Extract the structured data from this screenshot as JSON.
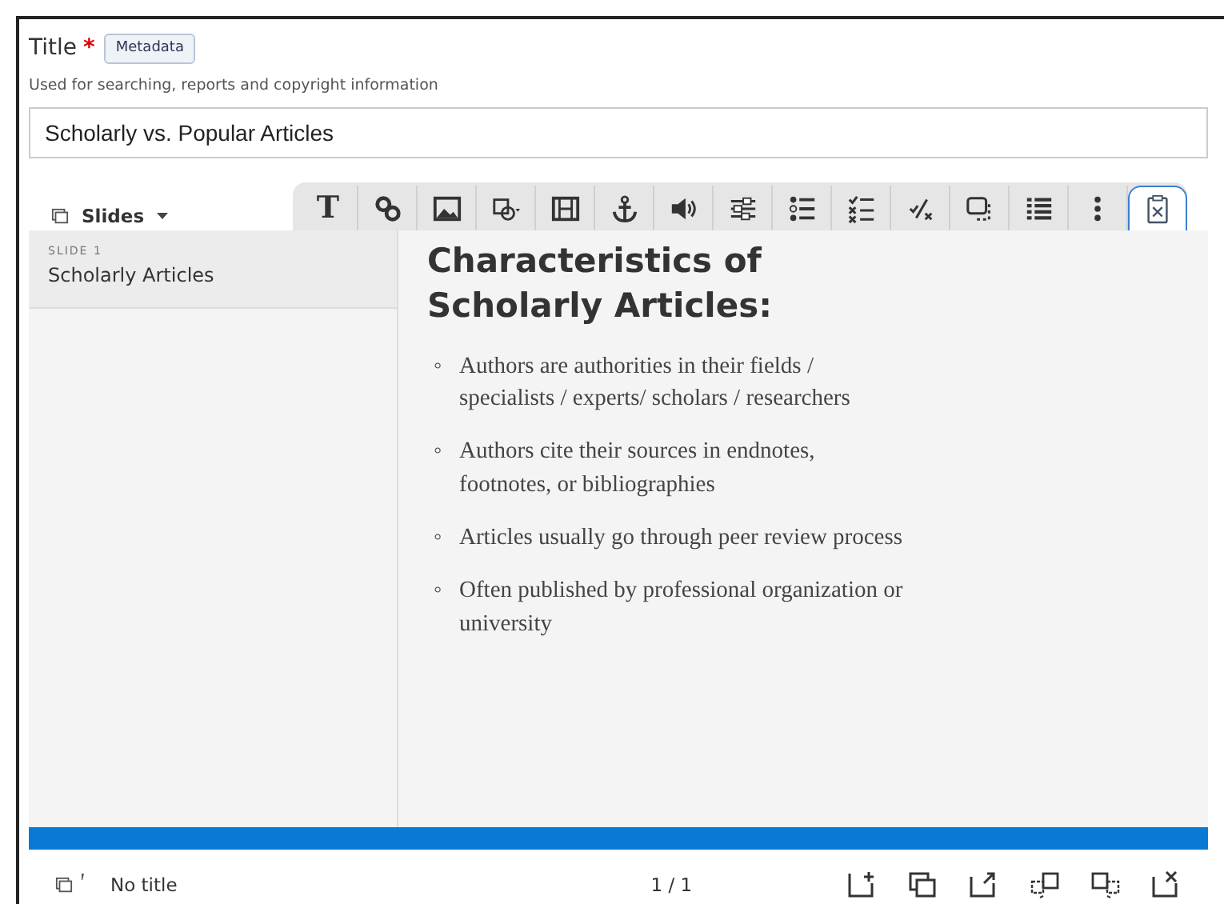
{
  "title_field": {
    "label": "Title",
    "required_mark": "*",
    "badge": "Metadata",
    "hint": "Used for searching, reports and copyright information",
    "value": "Scholarly vs. Popular Articles"
  },
  "slides_menu": {
    "label": "Slides"
  },
  "toolbar": [
    {
      "kind": "text",
      "label": "T",
      "selected": false
    },
    {
      "kind": "link",
      "selected": false
    },
    {
      "kind": "image",
      "selected": false
    },
    {
      "kind": "shape",
      "selected": false
    },
    {
      "kind": "film",
      "selected": false
    },
    {
      "kind": "anchor",
      "selected": false
    },
    {
      "kind": "audio",
      "selected": false
    },
    {
      "kind": "sliders",
      "selected": false
    },
    {
      "kind": "bullets",
      "selected": false
    },
    {
      "kind": "checklist",
      "selected": false
    },
    {
      "kind": "ratio",
      "selected": false
    },
    {
      "kind": "overlay",
      "selected": false
    },
    {
      "kind": "list",
      "selected": false
    },
    {
      "kind": "more",
      "selected": false
    },
    {
      "kind": "clipboard",
      "selected": true
    }
  ],
  "slides": [
    {
      "number": "SLIDE 1",
      "title": "Scholarly Articles",
      "selected": true
    }
  ],
  "slide_content": {
    "marker": "◦",
    "heading": "Characteristics of Scholarly Articles:",
    "bullets": [
      "Authors are authorities in their fields / specialists / experts/ scholars / researchers",
      "Authors cite their sources in endnotes, footnotes, or bibliographies",
      "Articles usually go through peer review process",
      "Often published by professional organization or university"
    ]
  },
  "footer": {
    "caption": "No title",
    "pager": "1 / 1",
    "actions": [
      {
        "kind": "add"
      },
      {
        "kind": "copy"
      },
      {
        "kind": "export"
      },
      {
        "kind": "move-left"
      },
      {
        "kind": "move-right"
      },
      {
        "kind": "delete"
      }
    ]
  }
}
